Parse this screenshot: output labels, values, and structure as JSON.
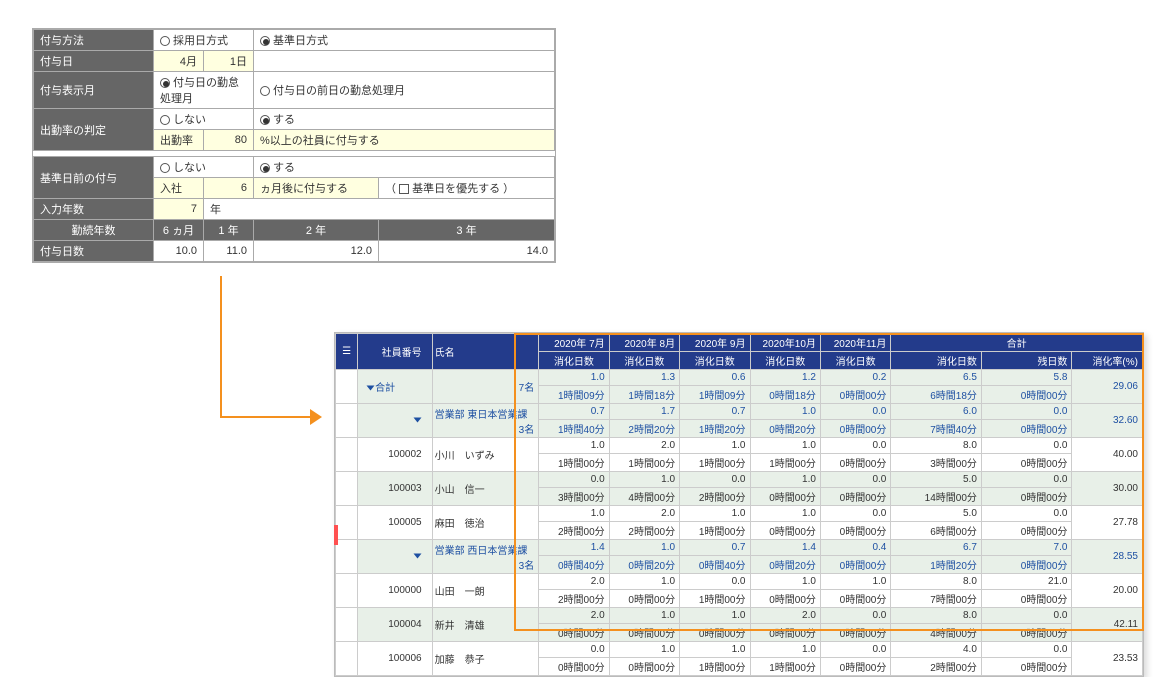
{
  "settings": {
    "method_label": "付与方法",
    "method_opt1": "採用日方式",
    "method_opt2": "基準日方式",
    "grant_date_label": "付与日",
    "grant_month": "4月",
    "grant_day": "1日",
    "display_month_label": "付与表示月",
    "display_opt1": "付与日の勤怠処理月",
    "display_opt2": "付与日の前日の勤怠処理月",
    "attendance_label": "出勤率の判定",
    "att_opt_no": "しない",
    "att_opt_yes": "する",
    "att_rate_lbl": "出勤率",
    "att_rate_val": "80",
    "att_suffix": "%以上の社員に付与する",
    "prebase_label": "基準日前の付与",
    "prebase_opt_no": "しない",
    "prebase_opt_yes": "する",
    "hire_lbl": "入社",
    "hire_val": "6",
    "hire_suffix": "ヵ月後に付与する",
    "hire_cb_lbl": "基準日を優先する",
    "input_years_label": "入力年数",
    "input_years_val": "7",
    "input_years_suffix": "年",
    "tenure_label": "勤続年数",
    "tenure_h": [
      "6 ヵ月",
      "1 年",
      "2 年",
      "3 年"
    ],
    "grant_days_label": "付与日数",
    "grant_days": [
      "10.0",
      "11.0",
      "12.0",
      "14.0"
    ]
  },
  "report": {
    "col_emp_no": "社員番号",
    "col_name": "氏名",
    "months": [
      "2020年 7月",
      "2020年 8月",
      "2020年 9月",
      "2020年10月",
      "2020年11月"
    ],
    "total_label": "合計",
    "sub_consume": "消化日数",
    "sub_remain": "残日数",
    "sub_rate": "消化率(%)",
    "total_row_label": "合計",
    "total_count": "7名",
    "total": {
      "d": [
        "1.0",
        "1.3",
        "0.6",
        "1.2",
        "0.2"
      ],
      "h": [
        "1時間09分",
        "1時間18分",
        "1時間09分",
        "0時間18分",
        "0時間00分"
      ],
      "td": "6.5",
      "th": "6時間18分",
      "rd": "5.8",
      "rh": "0時間00分",
      "rate": "29.06"
    },
    "group1_label": "営業部 東日本営業課",
    "group1_count": "3名",
    "group1": {
      "d": [
        "0.7",
        "1.7",
        "0.7",
        "1.0",
        "0.0"
      ],
      "h": [
        "1時間40分",
        "2時間20分",
        "1時間20分",
        "0時間20分",
        "0時間00分"
      ],
      "td": "6.0",
      "th": "7時間40分",
      "rd": "0.0",
      "rh": "0時間00分",
      "rate": "32.60"
    },
    "rows1": [
      {
        "id": "100002",
        "name": "小川　いずみ",
        "d": [
          "1.0",
          "2.0",
          "1.0",
          "1.0",
          "0.0"
        ],
        "h": [
          "1時間00分",
          "1時間00分",
          "1時間00分",
          "1時間00分",
          "0時間00分"
        ],
        "td": "8.0",
        "th": "3時間00分",
        "rd": "0.0",
        "rh": "0時間00分",
        "rate": "40.00",
        "alt": false
      },
      {
        "id": "100003",
        "name": "小山　信一",
        "d": [
          "0.0",
          "1.0",
          "0.0",
          "1.0",
          "0.0"
        ],
        "h": [
          "3時間00分",
          "4時間00分",
          "2時間00分",
          "0時間00分",
          "0時間00分"
        ],
        "td": "5.0",
        "th": "14時間00分",
        "rd": "0.0",
        "rh": "0時間00分",
        "rate": "30.00",
        "alt": true
      },
      {
        "id": "100005",
        "name": "麻田　徳治",
        "d": [
          "1.0",
          "2.0",
          "1.0",
          "1.0",
          "0.0"
        ],
        "h": [
          "2時間00分",
          "2時間00分",
          "1時間00分",
          "0時間00分",
          "0時間00分"
        ],
        "td": "5.0",
        "th": "6時間00分",
        "rd": "0.0",
        "rh": "0時間00分",
        "rate": "27.78",
        "alt": false
      }
    ],
    "group2_label": "営業部 西日本営業課",
    "group2_count": "3名",
    "group2": {
      "d": [
        "1.4",
        "1.0",
        "0.7",
        "1.4",
        "0.4"
      ],
      "h": [
        "0時間40分",
        "0時間20分",
        "0時間40分",
        "0時間20分",
        "0時間00分"
      ],
      "td": "6.7",
      "th": "1時間20分",
      "rd": "7.0",
      "rh": "0時間00分",
      "rate": "28.55"
    },
    "rows2": [
      {
        "id": "100000",
        "name": "山田　一朗",
        "d": [
          "2.0",
          "1.0",
          "0.0",
          "1.0",
          "1.0"
        ],
        "h": [
          "2時間00分",
          "0時間00分",
          "1時間00分",
          "0時間00分",
          "0時間00分"
        ],
        "td": "8.0",
        "th": "7時間00分",
        "rd": "21.0",
        "rh": "0時間00分",
        "rate": "20.00",
        "alt": false
      },
      {
        "id": "100004",
        "name": "新井　清雄",
        "d": [
          "2.0",
          "1.0",
          "1.0",
          "2.0",
          "0.0"
        ],
        "h": [
          "0時間00分",
          "0時間00分",
          "0時間00分",
          "0時間00分",
          "0時間00分"
        ],
        "td": "8.0",
        "th": "4時間00分",
        "rd": "0.0",
        "rh": "0時間00分",
        "rate": "42.11",
        "alt": true
      },
      {
        "id": "100006",
        "name": "加藤　恭子",
        "d": [
          "0.0",
          "1.0",
          "1.0",
          "1.0",
          "0.0"
        ],
        "h": [
          "0時間00分",
          "0時間00分",
          "1時間00分",
          "1時間00分",
          "0時間00分"
        ],
        "td": "4.0",
        "th": "2時間00分",
        "rd": "0.0",
        "rh": "0時間00分",
        "rate": "23.53",
        "alt": false
      }
    ]
  }
}
